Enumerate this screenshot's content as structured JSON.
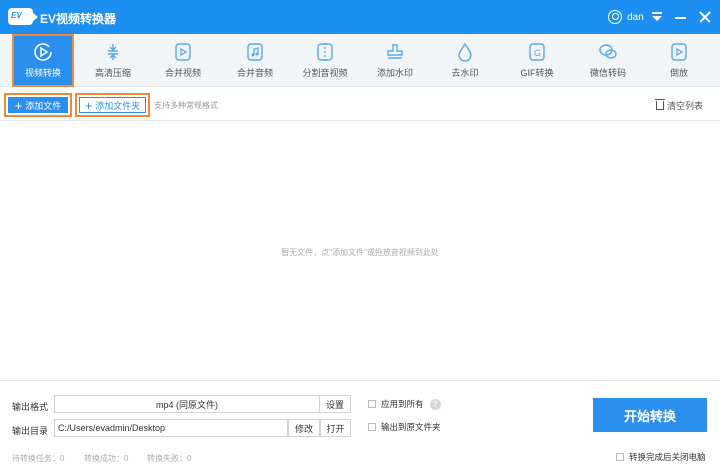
{
  "window": {
    "title": "EV视频转换器",
    "logo_text": "EV",
    "user": "dan",
    "accent": "#1d8ff0"
  },
  "toolbar": {
    "items": [
      {
        "label": "视频转换",
        "icon": "video-convert-icon",
        "active": true
      },
      {
        "label": "高清压缩",
        "icon": "compress-icon"
      },
      {
        "label": "合并视频",
        "icon": "merge-video-icon"
      },
      {
        "label": "合并音频",
        "icon": "merge-audio-icon"
      },
      {
        "label": "分割音视频",
        "icon": "split-icon"
      },
      {
        "label": "添加水印",
        "icon": "watermark-stamp-icon"
      },
      {
        "label": "去水印",
        "icon": "drop-icon"
      },
      {
        "label": "GIF转换",
        "icon": "gif-icon"
      },
      {
        "label": "微信转码",
        "icon": "wechat-icon"
      },
      {
        "label": "倒放",
        "icon": "reverse-play-icon"
      }
    ]
  },
  "actions": {
    "add_file": "添加文件",
    "add_folder": "添加文件夹",
    "hint": "支持多种常规格式",
    "clear": "清空列表"
  },
  "empty_message": "暂无文件，点\"添加文件\"或拖放音视频到此处",
  "output": {
    "format_label": "输出格式",
    "format_value": "mp4 (同原文件)",
    "settings": "设置",
    "dir_label": "输出目录",
    "dir_value": "C:/Users/evadmin/Desktop",
    "modify": "修改",
    "open": "打开",
    "apply_all": "应用到所有",
    "help": "?",
    "output_to_source": "输出到原文件夹"
  },
  "start_button": "开始转换",
  "status": {
    "pending": "待转换任务：0",
    "success": "转换成功：0",
    "failed": "转换失败：0"
  },
  "shutdown_label": "转换完成后关闭电脑"
}
